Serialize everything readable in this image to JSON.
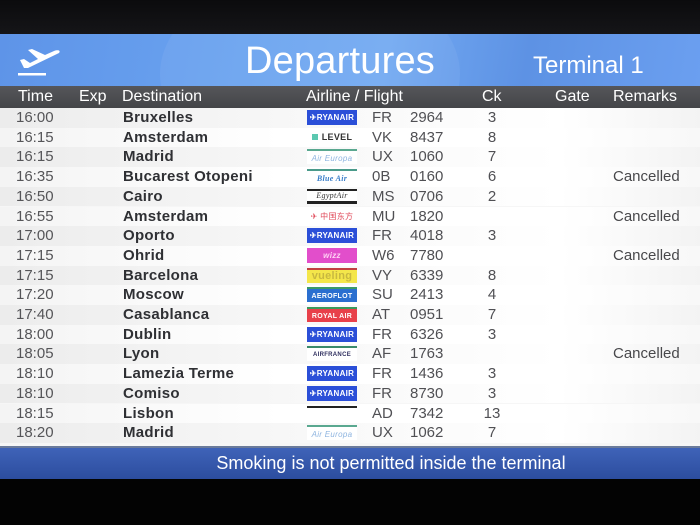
{
  "header": {
    "icon": "departing-plane-icon",
    "title": "Departures",
    "terminal": "Terminal 1"
  },
  "columns": {
    "time": "Time",
    "exp": "Exp",
    "destination": "Destination",
    "airline_flight": "Airline / Flight",
    "ck": "Ck",
    "gate": "Gate",
    "remarks": "Remarks"
  },
  "flights": [
    {
      "time": "16:00",
      "exp": "",
      "destination": "Bruxelles",
      "airline_logo": "ryanair",
      "logo_text": "✈RYANAIR",
      "code": "FR",
      "number": "2964",
      "ck": "3",
      "gate": "",
      "remarks": ""
    },
    {
      "time": "16:15",
      "exp": "",
      "destination": "Amsterdam",
      "airline_logo": "level",
      "logo_text": "LEVEL",
      "code": "VK",
      "number": "8437",
      "ck": "8",
      "gate": "",
      "remarks": ""
    },
    {
      "time": "16:15",
      "exp": "",
      "destination": "Madrid",
      "airline_logo": "aireuropa",
      "logo_text": "Air Europa",
      "code": "UX",
      "number": "1060",
      "ck": "7",
      "gate": "",
      "remarks": ""
    },
    {
      "time": "16:35",
      "exp": "",
      "destination": "Bucarest Otopeni",
      "airline_logo": "blueair",
      "logo_text": "Blue Air",
      "code": "0B",
      "number": "0160",
      "ck": "6",
      "gate": "",
      "remarks": "Cancelled"
    },
    {
      "time": "16:50",
      "exp": "",
      "destination": "Cairo",
      "airline_logo": "egyptair",
      "logo_text": "EgyptAir",
      "code": "MS",
      "number": "0706",
      "ck": "2",
      "gate": "",
      "remarks": ""
    },
    {
      "time": "16:55",
      "exp": "",
      "destination": "Amsterdam",
      "airline_logo": "chinaeastern",
      "logo_text": "✈ 中国东方航空",
      "code": "MU",
      "number": "1820",
      "ck": "",
      "gate": "",
      "remarks": "Cancelled"
    },
    {
      "time": "17:00",
      "exp": "",
      "destination": "Oporto",
      "airline_logo": "ryanair",
      "logo_text": "✈RYANAIR",
      "code": "FR",
      "number": "4018",
      "ck": "3",
      "gate": "",
      "remarks": ""
    },
    {
      "time": "17:15",
      "exp": "",
      "destination": "Ohrid",
      "airline_logo": "wizz",
      "logo_text": "wizz",
      "code": "W6",
      "number": "7780",
      "ck": "",
      "gate": "",
      "remarks": "Cancelled"
    },
    {
      "time": "17:15",
      "exp": "",
      "destination": "Barcelona",
      "airline_logo": "vueling",
      "logo_text": "vueling",
      "code": "VY",
      "number": "6339",
      "ck": "8",
      "gate": "",
      "remarks": ""
    },
    {
      "time": "17:20",
      "exp": "",
      "destination": "Moscow",
      "airline_logo": "aeroflot",
      "logo_text": "AEROFLOT",
      "code": "SU",
      "number": "2413",
      "ck": "4",
      "gate": "",
      "remarks": ""
    },
    {
      "time": "17:40",
      "exp": "",
      "destination": "Casablanca",
      "airline_logo": "ram",
      "logo_text": "ROYAL AIR MAROC",
      "code": "AT",
      "number": "0951",
      "ck": "7",
      "gate": "",
      "remarks": ""
    },
    {
      "time": "18:00",
      "exp": "",
      "destination": "Dublin",
      "airline_logo": "ryanair",
      "logo_text": "✈RYANAIR",
      "code": "FR",
      "number": "6326",
      "ck": "3",
      "gate": "",
      "remarks": ""
    },
    {
      "time": "18:05",
      "exp": "",
      "destination": "Lyon",
      "airline_logo": "airfrance",
      "logo_text": "AIRFRANCE",
      "code": "AF",
      "number": "1763",
      "ck": "",
      "gate": "",
      "remarks": "Cancelled"
    },
    {
      "time": "18:10",
      "exp": "",
      "destination": "Lamezia Terme",
      "airline_logo": "ryanair",
      "logo_text": "✈RYANAIR",
      "code": "FR",
      "number": "1436",
      "ck": "3",
      "gate": "",
      "remarks": ""
    },
    {
      "time": "18:10",
      "exp": "",
      "destination": "Comiso",
      "airline_logo": "ryanair",
      "logo_text": "✈RYANAIR",
      "code": "FR",
      "number": "8730",
      "ck": "3",
      "gate": "",
      "remarks": ""
    },
    {
      "time": "18:15",
      "exp": "",
      "destination": "Lisbon",
      "airline_logo": "andorra",
      "logo_text": "",
      "code": "AD",
      "number": "7342",
      "ck": "13",
      "gate": "",
      "remarks": ""
    },
    {
      "time": "18:20",
      "exp": "",
      "destination": "Madrid",
      "airline_logo": "aireuropa",
      "logo_text": "Air Europa",
      "code": "UX",
      "number": "1062",
      "ck": "7",
      "gate": "",
      "remarks": ""
    }
  ],
  "footer": {
    "message": "Smoking is not permitted inside the terminal"
  },
  "colors": {
    "header_blue": "#6aa3f0",
    "column_header_gray": "#4c4d50",
    "footer_blue": "#3358ab",
    "ryanair_blue": "#2b4fd8"
  }
}
